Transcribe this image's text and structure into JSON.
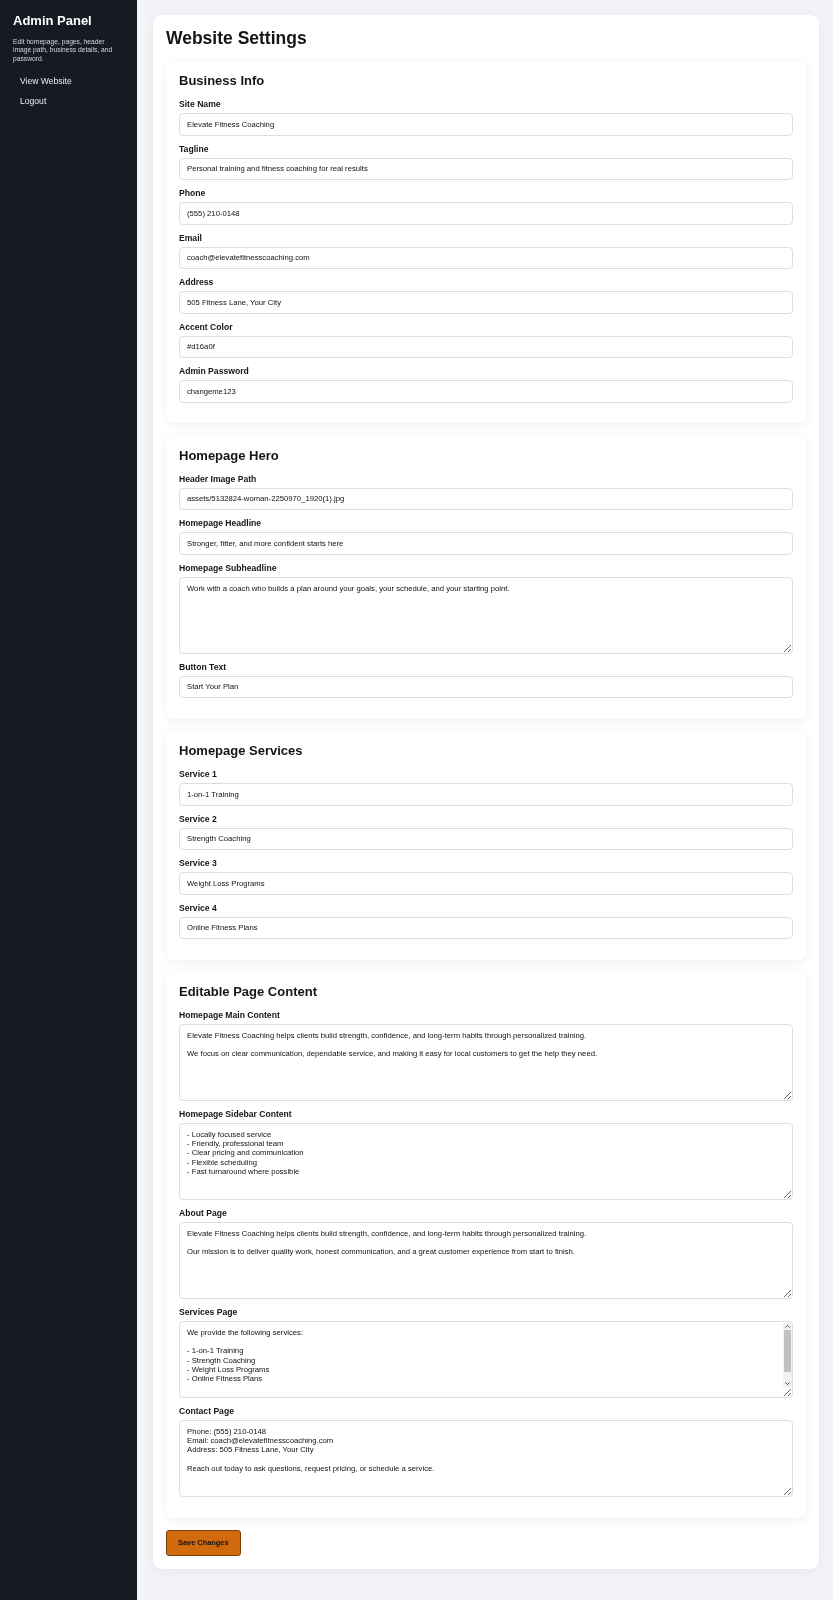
{
  "sidebar": {
    "title": "Admin Panel",
    "description": "Edit homepage, pages, header image path, business details, and password.",
    "links": [
      "View Website",
      "Logout"
    ]
  },
  "page": {
    "title": "Website Settings"
  },
  "sections": [
    {
      "heading": "Business Info",
      "fields": [
        {
          "label": "Site Name",
          "kind": "input",
          "value": "Elevate Fitness Coaching"
        },
        {
          "label": "Tagline",
          "kind": "input",
          "value": "Personal training and fitness coaching for real results"
        },
        {
          "label": "Phone",
          "kind": "input",
          "value": "(555) 210-0148"
        },
        {
          "label": "Email",
          "kind": "input",
          "value": "coach@elevatefitnesscoaching.com"
        },
        {
          "label": "Address",
          "kind": "input",
          "value": "505 Fitness Lane, Your City"
        },
        {
          "label": "Accent Color",
          "kind": "input",
          "value": "#d16a0f"
        },
        {
          "label": "Admin Password",
          "kind": "input",
          "value": "changeme123"
        }
      ]
    },
    {
      "heading": "Homepage Hero",
      "fields": [
        {
          "label": "Header Image Path",
          "kind": "input",
          "value": "assets/5132824-woman-2250970_1920(1).jpg"
        },
        {
          "label": "Homepage Headline",
          "kind": "input",
          "value": "Stronger, fitter, and more confident starts here"
        },
        {
          "label": "Homepage Subheadline",
          "kind": "textarea",
          "scrollable": false,
          "value": "Work with a coach who builds a plan around your goals, your schedule, and your starting point."
        },
        {
          "label": "Button Text",
          "kind": "input",
          "value": "Start Your Plan"
        }
      ]
    },
    {
      "heading": "Homepage Services",
      "fields": [
        {
          "label": "Service 1",
          "kind": "input",
          "value": "1-on-1 Training"
        },
        {
          "label": "Service 2",
          "kind": "input",
          "value": "Strength Coaching"
        },
        {
          "label": "Service 3",
          "kind": "input",
          "value": "Weight Loss Programs"
        },
        {
          "label": "Service 4",
          "kind": "input",
          "value": "Online Fitness Plans"
        }
      ]
    },
    {
      "heading": "Editable Page Content",
      "fields": [
        {
          "label": "Homepage Main Content",
          "kind": "textarea",
          "scrollable": false,
          "value": "Elevate Fitness Coaching helps clients build strength, confidence, and long-term habits through personalized training.\n\nWe focus on clear communication, dependable service, and making it easy for local customers to get the help they need."
        },
        {
          "label": "Homepage Sidebar Content",
          "kind": "textarea",
          "scrollable": false,
          "value": "- Locally focused service\n- Friendly, professional team\n- Clear pricing and communication\n- Flexible scheduling\n- Fast turnaround where possible"
        },
        {
          "label": "About Page",
          "kind": "textarea",
          "scrollable": false,
          "value": "Elevate Fitness Coaching helps clients build strength, confidence, and long-term habits through personalized training.\n\nOur mission is to deliver quality work, honest communication, and a great customer experience from start to finish."
        },
        {
          "label": "Services Page",
          "kind": "textarea",
          "scrollable": true,
          "value": "We provide the following services:\n\n- 1-on-1 Training\n- Strength Coaching\n- Weight Loss Programs\n- Online Fitness Plans"
        },
        {
          "label": "Contact Page",
          "kind": "textarea",
          "scrollable": false,
          "value": "Phone: (555) 210-0148\nEmail: coach@elevatefitnesscoaching.com\nAddress: 505 Fitness Lane, Your City\n\nReach out today to ask questions, request pricing, or schedule a service."
        }
      ]
    }
  ],
  "save_button": "Save Changes"
}
